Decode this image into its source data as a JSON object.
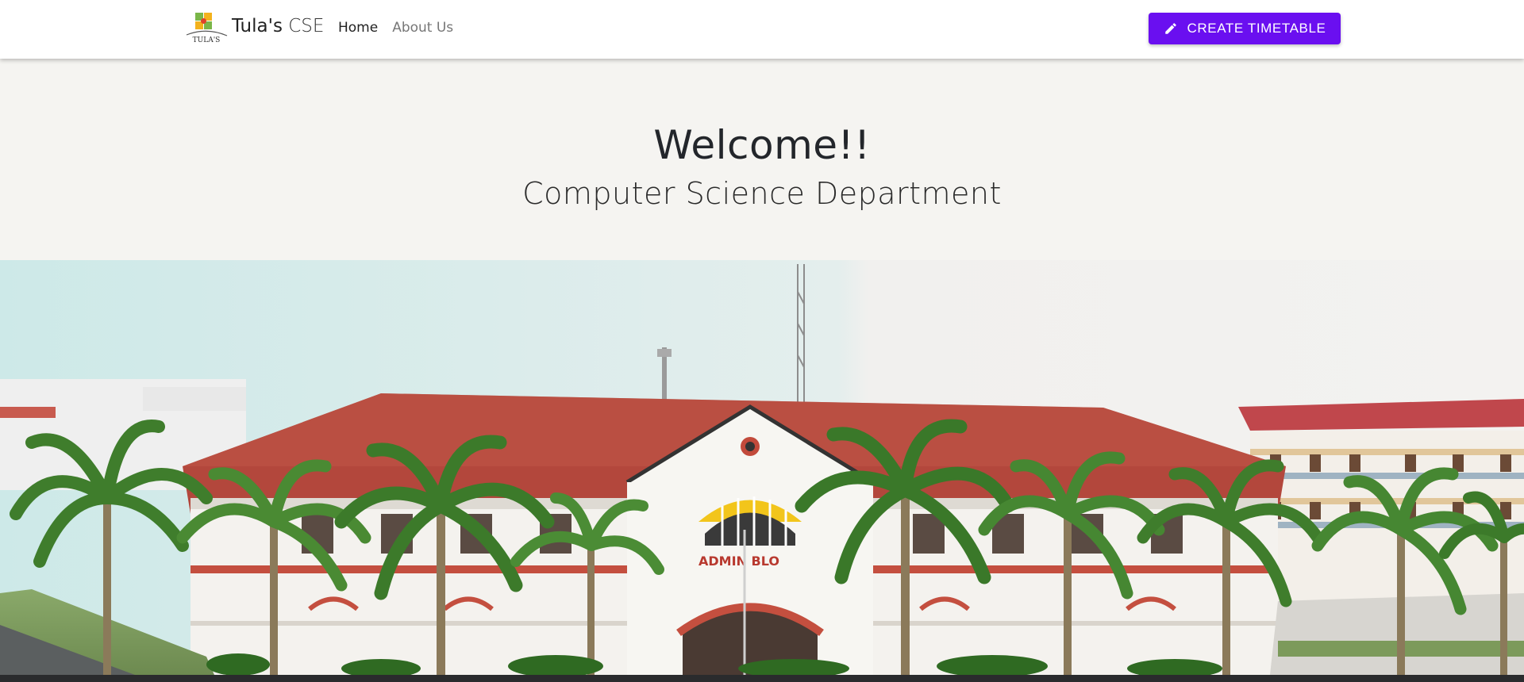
{
  "navbar": {
    "brand": {
      "name_strong": "Tula's",
      "name_light": "CSE",
      "logo_text": "TULA'S",
      "logo_icon": "tulas-logo-icon"
    },
    "links": [
      {
        "label": "Home",
        "active": true
      },
      {
        "label": "About Us",
        "active": false
      }
    ],
    "cta": {
      "label": "CREATE TIMETABLE",
      "icon": "pencil-icon",
      "color": "#6a0ff0"
    }
  },
  "hero": {
    "title": "Welcome!!",
    "subtitle": "Computer Science Department"
  },
  "campus_image": {
    "sign_text": "ADMIN BLO"
  },
  "colors": {
    "page_bg": "#f5f4f1",
    "navbar_bg": "#ffffff",
    "accent": "#6a0ff0",
    "roof": "#b3473c",
    "building": "#f4f2ee"
  }
}
